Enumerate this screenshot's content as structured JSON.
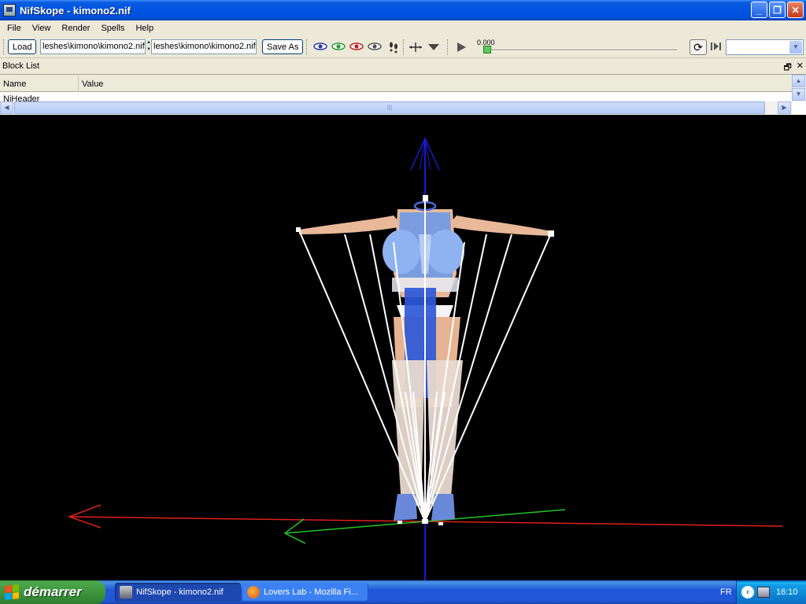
{
  "window": {
    "title": "NifSkope - kimono2.nif",
    "minimize_glyph": "_",
    "maximize_glyph": "❐",
    "close_glyph": "✕"
  },
  "menu": {
    "items": [
      "File",
      "View",
      "Render",
      "Spells",
      "Help"
    ]
  },
  "toolbar": {
    "load_label": "Load",
    "load_path": "leshes\\kimono\\kimono2.nif",
    "save_path": "leshes\\kimono\\kimono2.nif",
    "save_as_label": "Save As",
    "time_value": "0.000",
    "animation_select_value": "",
    "view_icons": [
      "eye-blue-icon",
      "eye-green-icon",
      "eye-red-icon",
      "eye-gray-icon",
      "footprints-icon",
      "axes-icon",
      "down-arrow-icon"
    ]
  },
  "block_list": {
    "title": "Block List",
    "float_glyph": "🗗",
    "close_glyph": "✕",
    "columns": [
      "Name",
      "Value"
    ],
    "rows": [
      "NiHeader"
    ]
  },
  "taskbar": {
    "start_label": "démarrer",
    "tasks": [
      {
        "label": "NifSkope - kimono2.nif",
        "active": true
      },
      {
        "label": "Lovers Lab - Mozilla Fi...",
        "active": false
      }
    ],
    "language": "FR",
    "clock": "16:10"
  },
  "colors": {
    "axis_x": "#e0201c",
    "axis_y": "#22c424",
    "axis_z": "#1a1ad0",
    "viewport_bg": "#000000",
    "title_bar": "#0054e3"
  }
}
